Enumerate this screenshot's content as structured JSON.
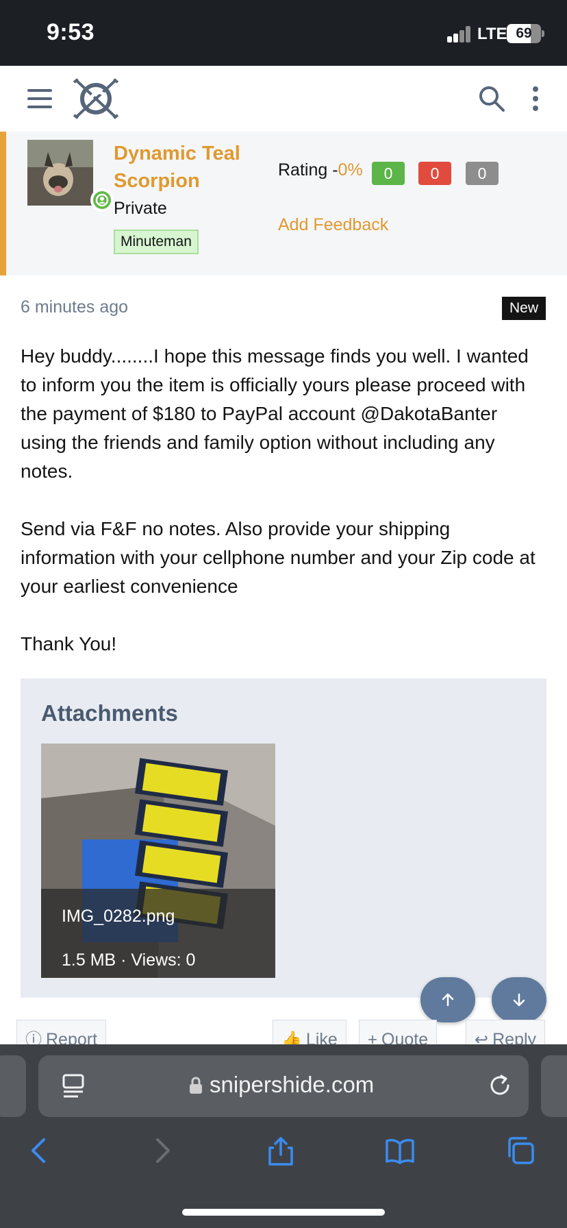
{
  "status_bar": {
    "time": "9:53",
    "network": "LTE",
    "battery": "69"
  },
  "header": {
    "menu_icon": "hamburger-icon",
    "logo": "snipershide-logo",
    "search_icon": "search-icon",
    "more_icon": "vertical-dots-icon"
  },
  "user": {
    "name_line1": "Dynamic Teal",
    "name_line2": "Scorpion",
    "title": "Private",
    "banner": "Minuteman",
    "rating_label": "Rating -",
    "rating_pct": "0%",
    "ratings": {
      "positive": "0",
      "negative": "0",
      "neutral": "0"
    },
    "add_feedback": "Add Feedback",
    "colors": {
      "accent": "#e0992f",
      "positive": "#5cb548",
      "negative": "#e04b3e",
      "neutral": "#8d8d8d"
    }
  },
  "message": {
    "time": "6 minutes ago",
    "badge": "New",
    "paragraph1": "Hey buddy........I hope this message finds you well. I wanted to inform you the item is officially yours please proceed with the payment of $180 to PayPal account @DakotaBanter using the friends and family option without including any notes.",
    "paragraph2": "Send via F&F no notes. Also provide your shipping information with your cellphone number and your Zip code at your earliest convenience",
    "paragraph3": "Thank You!"
  },
  "attachments": {
    "title": "Attachments",
    "items": [
      {
        "name": "IMG_0282.png",
        "meta": "1.5 MB · Views: 0"
      }
    ]
  },
  "actions": {
    "report": "Report",
    "like": "Like",
    "quote": "Quote",
    "reply": "Reply"
  },
  "browser": {
    "url": "snipershide.com"
  }
}
